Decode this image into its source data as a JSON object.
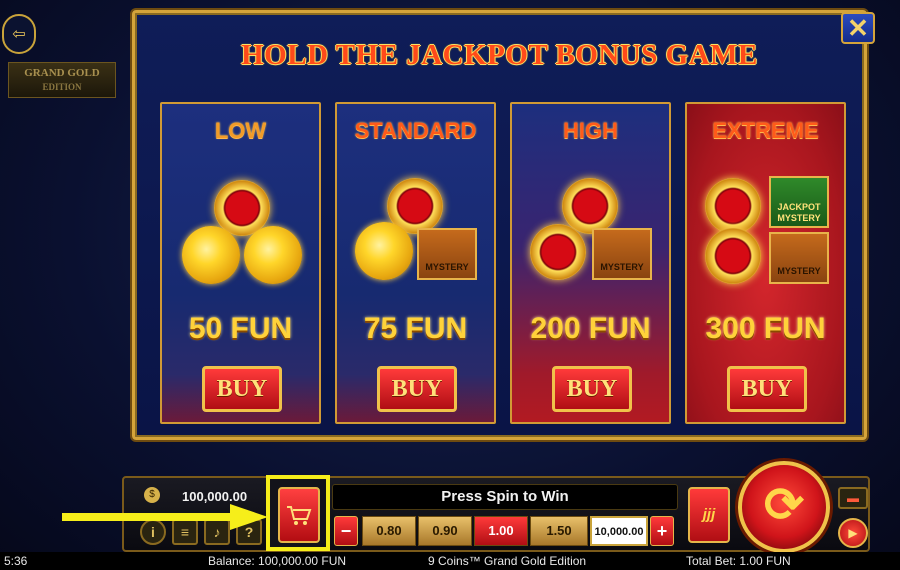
{
  "header": {
    "exit_icon": "exit-door-icon",
    "logo_line1": "GRAND GOLD",
    "logo_line2": "EDITION"
  },
  "modal": {
    "title": "HOLD THE JACKPOT BONUS GAME",
    "close_label": "✕",
    "cards": [
      {
        "title": "LOW",
        "price": "50 FUN",
        "buy_label": "BUY",
        "theme": "blue"
      },
      {
        "title": "STANDARD",
        "price": "75 FUN",
        "buy_label": "BUY",
        "theme": "blue",
        "symbol": "MYSTERY"
      },
      {
        "title": "HIGH",
        "price": "200 FUN",
        "buy_label": "BUY",
        "theme": "red-blue",
        "symbol": "MYSTERY"
      },
      {
        "title": "EXTREME",
        "price": "300 FUN",
        "buy_label": "BUY",
        "theme": "red",
        "symbol": "MYSTERY",
        "symbol2": "JACKPOT MYSTERY"
      }
    ]
  },
  "panel": {
    "balance_value": "100,000.00",
    "message": "Press Spin to Win",
    "bet_minus": "−",
    "bet_plus": "+",
    "bets": [
      "0.80",
      "0.90",
      "1.00",
      "1.50",
      "10,000.00"
    ],
    "selected_bet": "1.00",
    "turbo_label": "jjj",
    "spin_icon": "⟳",
    "info_icon": "i",
    "menu_icon": "≡",
    "help_icon": "?",
    "cart_icon": "🛒",
    "colors": {
      "accent_gold": "#d5a43a",
      "highlight": "#f6ee1a",
      "red": "#d0141a"
    }
  },
  "status": {
    "time": "5:36",
    "balance": "Balance: 100,000.00 FUN",
    "game_name": "9 Coins™ Grand Gold Edition",
    "total_bet": "Total Bet: 1.00 FUN"
  }
}
